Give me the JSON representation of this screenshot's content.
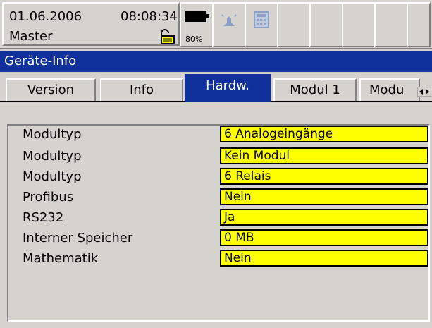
{
  "header": {
    "date": "01.06.2006",
    "time": "08:08:34",
    "user": "Master",
    "battery_percent": "80%"
  },
  "window": {
    "title": "Geräte-Info"
  },
  "tabs": [
    {
      "label": "Version",
      "active": false
    },
    {
      "label": "Info",
      "active": false
    },
    {
      "label": "Hardw.",
      "active": true
    },
    {
      "label": "Modul 1",
      "active": false
    },
    {
      "label": "Modu",
      "active": false
    }
  ],
  "rows": [
    {
      "label": "Modultyp",
      "value": "6 Analogeingänge"
    },
    {
      "label": "Modultyp",
      "value": "Kein Modul"
    },
    {
      "label": "Modultyp",
      "value": "6 Relais"
    },
    {
      "label": "Profibus",
      "value": "Nein"
    },
    {
      "label": "RS232",
      "value": "Ja"
    },
    {
      "label": "Interner Speicher",
      "value": "0 MB"
    },
    {
      "label": "Mathematik",
      "value": "Nein"
    }
  ],
  "colors": {
    "title_bg": "#10309c",
    "value_bg": "#ffff00",
    "panel_bg": "#d6d3ce"
  }
}
